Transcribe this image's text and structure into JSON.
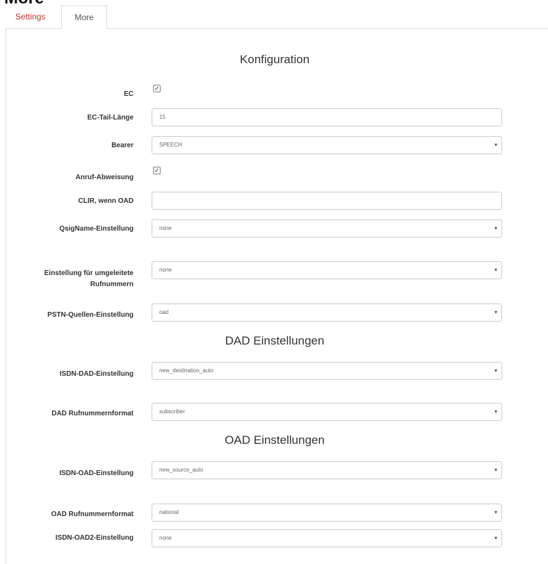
{
  "page": {
    "heading": "More"
  },
  "tabs": [
    {
      "label": "Settings"
    },
    {
      "label": "More"
    }
  ],
  "sections": {
    "konfiguration": "Konfiguration",
    "dad": "DAD Einstellungen",
    "oad": "OAD Einstellungen"
  },
  "fields": {
    "ec": {
      "label": "EC",
      "checked": true
    },
    "ec_tail": {
      "label": "EC-Tail-Länge",
      "value": "15"
    },
    "bearer": {
      "label": "Bearer",
      "value": "SPEECH"
    },
    "call_reject": {
      "label": "Anruf-Abweisung",
      "checked": true
    },
    "clir": {
      "label": "CLIR, wenn OAD",
      "value": ""
    },
    "qsig": {
      "label": "QsigName-Einstellung",
      "value": "none"
    },
    "redirect_line1": "Einstellung für umgeleitete",
    "redirect_line2": "Rufnummern",
    "redirect": {
      "value": "none"
    },
    "pstn": {
      "label": "PSTN-Quellen-Einstellung",
      "value": "oad"
    },
    "isdn_dad": {
      "label": "ISDN-DAD-Einstellung",
      "value": "new_destination_auto"
    },
    "dad_format": {
      "label": "DAD Rufnummernformat",
      "value": "subscriber"
    },
    "isdn_oad": {
      "label": "ISDN-OAD-Einstellung",
      "value": "new_source_auto"
    },
    "oad_format": {
      "label": "OAD Rufnummernformat",
      "value": "national"
    },
    "isdn_oad2": {
      "label": "ISDN-OAD2-Einstellung",
      "value": "none"
    }
  },
  "icons": {
    "caret": "▾",
    "check": "✓"
  }
}
